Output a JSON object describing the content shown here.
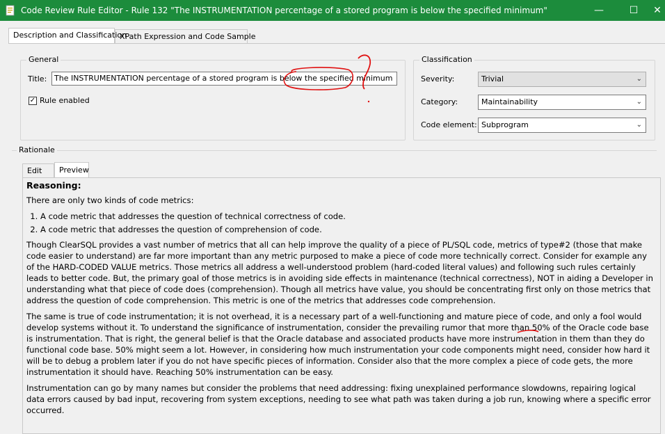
{
  "window": {
    "title": "Code Review Rule Editor - Rule 132 \"The INSTRUMENTATION percentage of a stored program is below the specified minimum\"",
    "minimize": "—",
    "maximize": "☐",
    "close": "✕"
  },
  "tabs": [
    {
      "label": "Description and Classification"
    },
    {
      "label": "XPath Expression and Code Sample"
    }
  ],
  "general": {
    "legend": "General",
    "title_label": "Title:",
    "title_value": "The INSTRUMENTATION percentage of a stored program is below the specified minimum",
    "rule_enabled_label": "Rule enabled",
    "rule_enabled_checked": true
  },
  "classification": {
    "legend": "Classification",
    "severity_label": "Severity:",
    "severity_value": "Trivial",
    "category_label": "Category:",
    "category_value": "Maintainability",
    "code_element_label": "Code element:",
    "code_element_value": "Subprogram"
  },
  "rationale": {
    "legend": "Rationale",
    "tab_edit": "Edit",
    "tab_preview": "Preview",
    "heading": "Reasoning:",
    "intro": "There are only two kinds of code metrics:",
    "list": [
      "A code metric that addresses the question of technical correctness of code.",
      "A code metric that addresses the question of comprehension of code."
    ],
    "paragraphs": [
      "Though ClearSQL provides a vast number of metrics that all can help improve the quality of a piece of PL/SQL code, metrics of type#2 (those that make code easier to understand) are far more important than any metric purposed to make a piece of code more technically correct. Consider for example any of the HARD-CODED VALUE metrics. Those metrics all address a well-understood problem (hard-coded literal values) and following such rules certainly leads to better code. But, the primary goal of those metrics is in avoiding side effects in maintenance (technical correctness), NOT in aiding a Developer in understanding what that piece of code does (comprehension). Though all metrics have value, you should be concentrating first only on those metrics that address the question of code comprehension. This metric is one of the metrics that addresses code comprehension.",
      "The same is true of code instrumentation; it is not overhead, it is a necessary part of a well-functioning and mature piece of code, and only a fool would develop systems without it. To understand the significance of instrumentation, consider the prevailing rumor that more than 50% of the Oracle code base is instrumentation. That is right, the general belief is that the Oracle database and associated products have more instrumentation in them than they do functional code base. 50% might seem a lot. However, in considering how much instrumentation your code components might need, consider how hard it will be to debug a problem later if you do not have specific pieces of information. Consider also that the more complex a piece of code gets, the more instrumentation it should have. Reaching 50% instrumentation can be easy.",
      "Instrumentation can go by many names but consider the problems that need addressing: fixing unexplained performance slowdowns, repairing logical data errors caused by bad input, recovering from system exceptions, needing to see what path was taken during a job run, knowing where a specific error occurred."
    ]
  },
  "colors": {
    "titlebar": "#1c8c3c",
    "annotation": "#e01010"
  }
}
